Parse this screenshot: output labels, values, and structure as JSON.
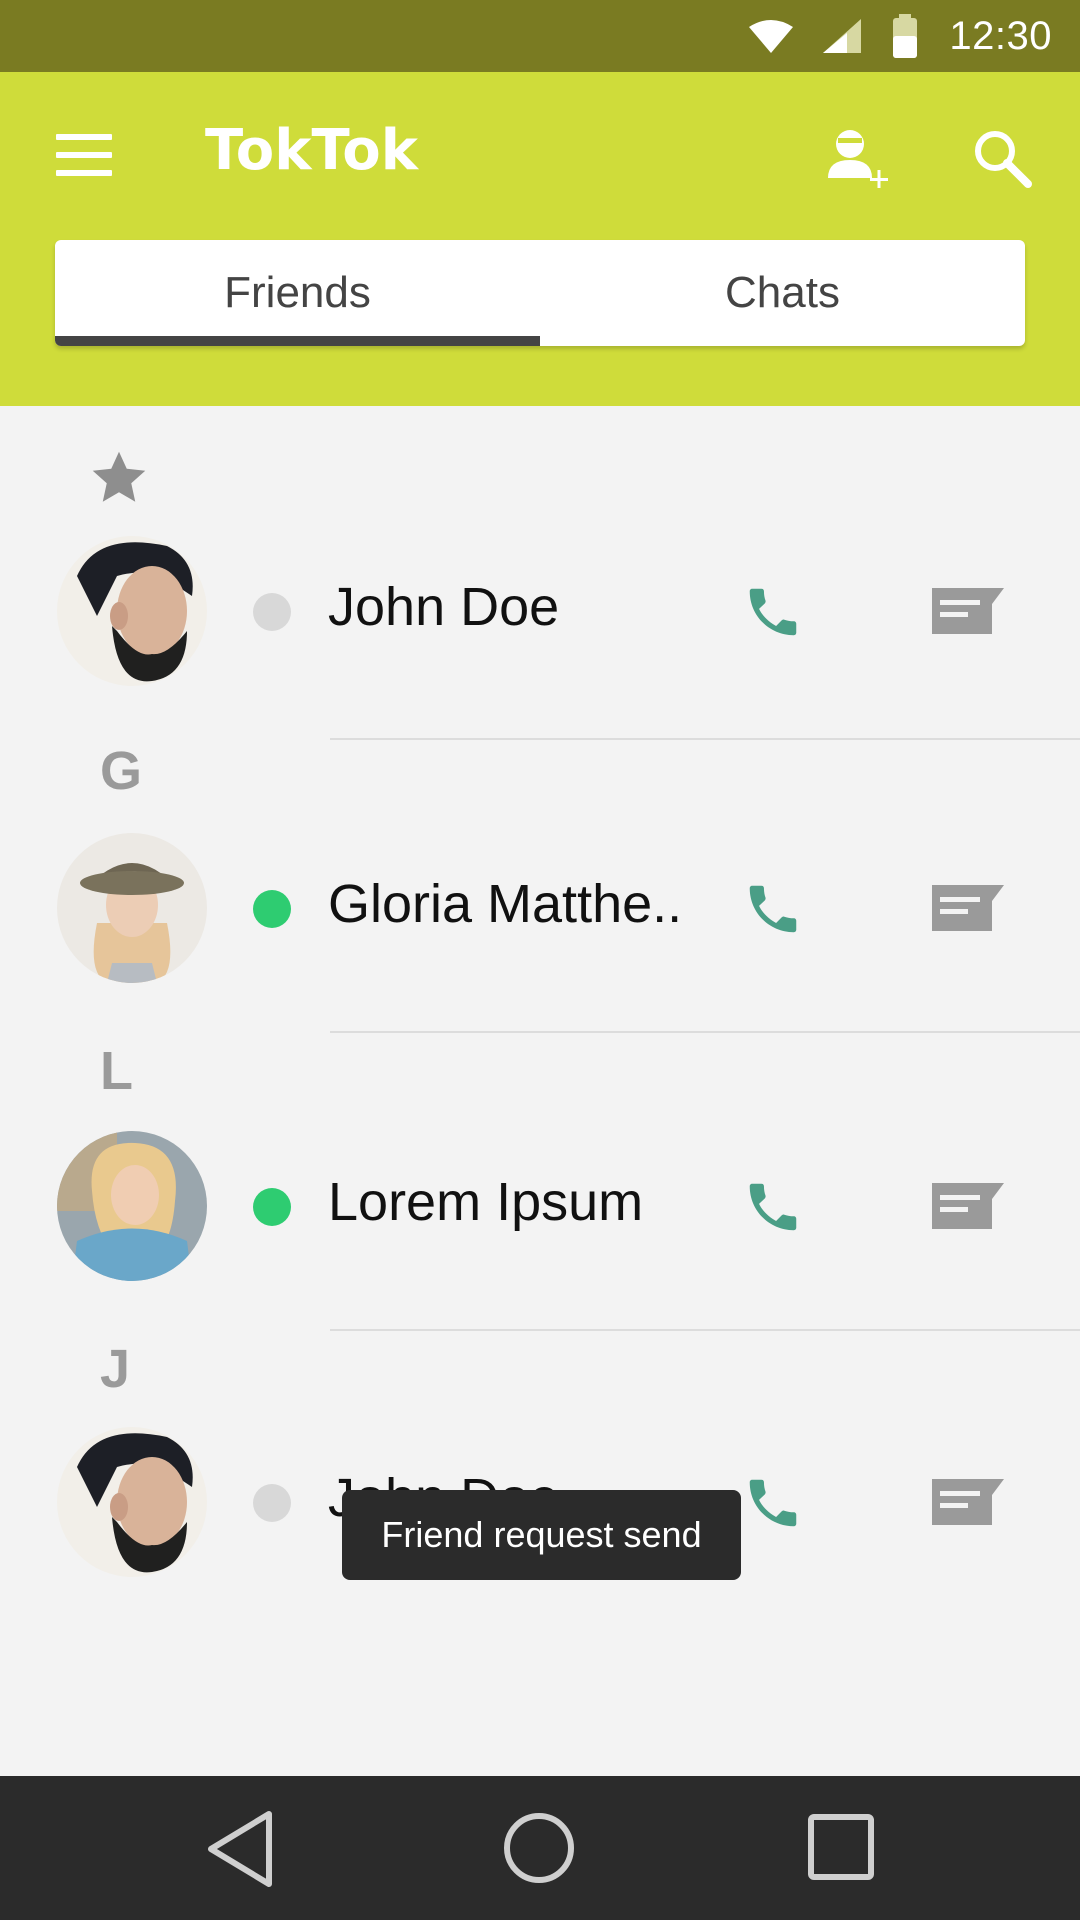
{
  "status_bar": {
    "time": "12:30",
    "icons": [
      "wifi-icon",
      "signal-icon",
      "battery-icon"
    ]
  },
  "app_bar": {
    "title": "TokTok",
    "icons": [
      "menu-icon",
      "add-friend-icon",
      "search-icon"
    ],
    "background_color": "#cfdc3a"
  },
  "tabs": [
    {
      "label": "Friends",
      "active": true
    },
    {
      "label": "Chats",
      "active": false
    }
  ],
  "sections": [
    {
      "header": "",
      "icon": "star-icon",
      "friends": [
        {
          "name": "John Doe",
          "status": "offline"
        }
      ]
    },
    {
      "header": "G",
      "friends": [
        {
          "name": "Gloria Matthe..",
          "status": "online"
        }
      ]
    },
    {
      "header": "L",
      "friends": [
        {
          "name": "Lorem Ipsum",
          "status": "online"
        }
      ]
    },
    {
      "header": "J",
      "friends": [
        {
          "name": "John Doe",
          "status": "offline"
        }
      ]
    }
  ],
  "colors": {
    "online": "#2ecc71",
    "offline": "#d8d8d8",
    "call": "#4a9e86",
    "message": "#9a9a9a"
  },
  "toast": {
    "message": "Friend request send"
  },
  "nav_bar": {
    "icons": [
      "back-icon",
      "home-icon",
      "recents-icon"
    ]
  }
}
